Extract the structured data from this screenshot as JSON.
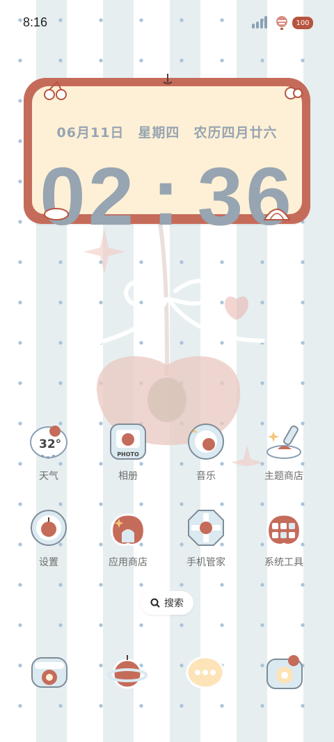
{
  "status_bar": {
    "time": "8:16",
    "battery": "100"
  },
  "widget": {
    "date": "06月11日",
    "weekday": "星期四",
    "lunar": "农历四月廿六",
    "clock_hours": "02",
    "clock_minutes": "36"
  },
  "weather": {
    "temperature": "32°"
  },
  "apps": [
    {
      "label": "天气",
      "icon": "weather-icon"
    },
    {
      "label": "相册",
      "icon": "photo-album-icon"
    },
    {
      "label": "音乐",
      "icon": "music-icon"
    },
    {
      "label": "主题商店",
      "icon": "theme-store-icon"
    },
    {
      "label": "设置",
      "icon": "settings-icon"
    },
    {
      "label": "应用商店",
      "icon": "app-store-icon"
    },
    {
      "label": "手机管家",
      "icon": "phone-manager-icon"
    },
    {
      "label": "系统工具",
      "icon": "system-tools-icon"
    }
  ],
  "photo_badge": "PHOTO",
  "search": {
    "label": "搜索"
  },
  "dock": [
    {
      "icon": "phone-icon"
    },
    {
      "icon": "browser-icon"
    },
    {
      "icon": "messages-icon"
    },
    {
      "icon": "camera-icon"
    }
  ],
  "colors": {
    "accent": "#c56b5a",
    "clock": "#97a4b1",
    "widget_bg": "#fdf0d6"
  }
}
